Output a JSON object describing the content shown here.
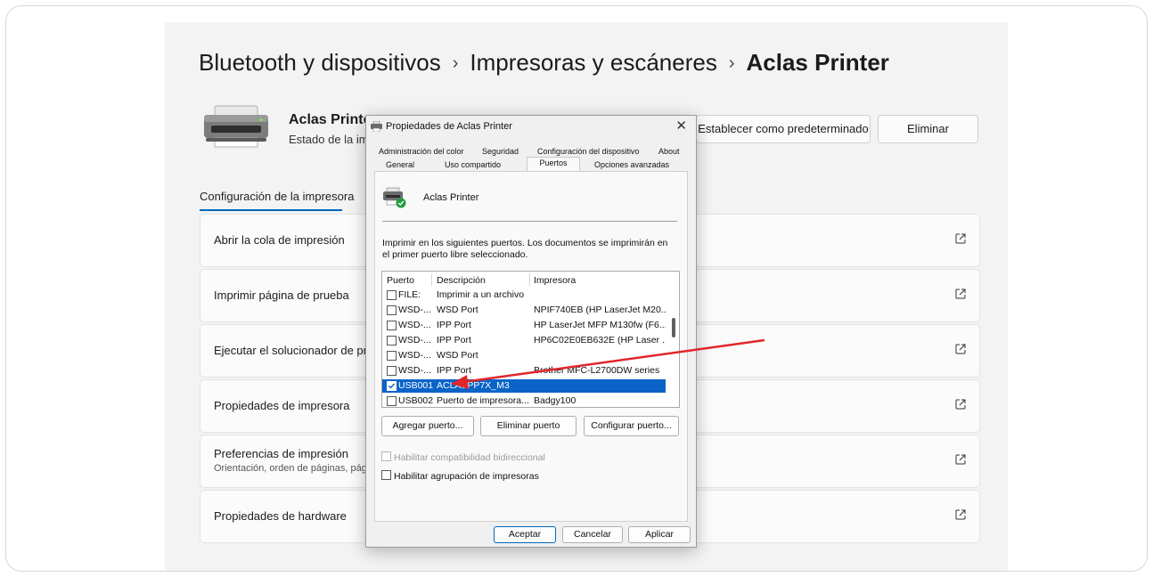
{
  "breadcrumb": {
    "level1": "Bluetooth y dispositivos",
    "level2": "Impresoras y escáneres",
    "current": "Aclas Printer",
    "separator": "›"
  },
  "printer_header": {
    "name": "Aclas Printer",
    "status": "Estado de la impr",
    "set_default_label": "Establecer como predeterminado",
    "remove_label": "Eliminar"
  },
  "settings": {
    "section_title": "Configuración de la impresora",
    "items": [
      {
        "label": "Abrir la cola de impresión"
      },
      {
        "label": "Imprimir página de prueba"
      },
      {
        "label": "Ejecutar el solucionador de probl"
      },
      {
        "label": "Propiedades de impresora"
      },
      {
        "label": "Preferencias de impresión",
        "sublabel": "Orientación, orden de páginas, págin"
      },
      {
        "label": "Propiedades de hardware"
      }
    ],
    "external_icon": "open-external-icon"
  },
  "dialog": {
    "title": "Propiedades de Aclas Printer",
    "close_glyph": "✕",
    "tabs_row1": [
      "Administración del color",
      "Seguridad",
      "Configuración del dispositivo",
      "About"
    ],
    "tabs_row2": [
      "General",
      "Uso compartido",
      "Puertos",
      "Opciones avanzadas"
    ],
    "active_tab": "Puertos",
    "printer_name": "Aclas Printer",
    "description": "Imprimir en los siguientes puertos. Los documentos se imprimirán en el primer puerto libre seleccionado.",
    "columns": [
      "Puerto",
      "Descripción",
      "Impresora"
    ],
    "ports": [
      {
        "port": "FILE:",
        "description": "Imprimir a un archivo",
        "printer": "",
        "checked": false
      },
      {
        "port": "WSD-...",
        "description": "WSD Port",
        "printer": "NPIF740EB (HP LaserJet M20...",
        "checked": false
      },
      {
        "port": "WSD-...",
        "description": "IPP Port",
        "printer": "HP LaserJet MFP M130fw (F6...",
        "checked": false
      },
      {
        "port": "WSD-...",
        "description": "IPP Port",
        "printer": "HP6C02E0EB632E (HP Laser ...",
        "checked": false
      },
      {
        "port": "WSD-...",
        "description": "WSD Port",
        "printer": "",
        "checked": false
      },
      {
        "port": "WSD-...",
        "description": "IPP Port",
        "printer": "Brother MFC-L2700DW series",
        "checked": false
      },
      {
        "port": "USB001",
        "description": "ACLASPP7X_M3",
        "printer": "",
        "checked": true
      },
      {
        "port": "USB002",
        "description": "Puerto de impresora...",
        "printer": "Badgy100",
        "checked": false
      }
    ],
    "add_port_label": "Agregar puerto...",
    "delete_port_label": "Eliminar puerto",
    "configure_port_label": "Configurar puerto...",
    "bidirectional_label": "Habilitar compatibilidad bidireccional",
    "pooling_label": "Habilitar agrupación de impresoras",
    "ok_label": "Aceptar",
    "cancel_label": "Cancelar",
    "apply_label": "Aplicar"
  },
  "colors": {
    "accent": "#0067c0",
    "selection": "#0a64c8",
    "annotation_arrow": "#e0262a"
  }
}
